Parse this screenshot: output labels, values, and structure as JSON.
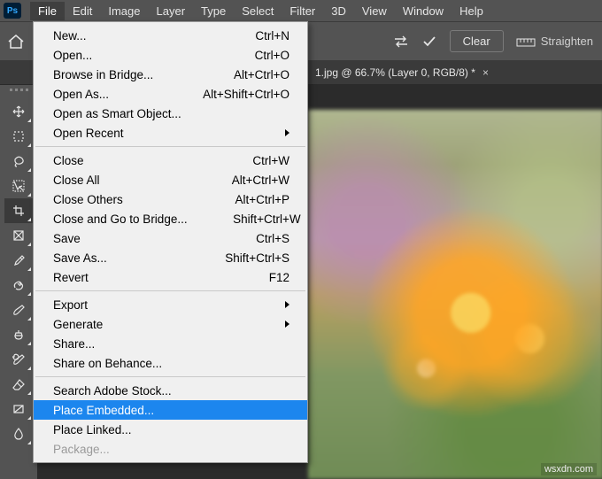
{
  "menubar": {
    "items": [
      "File",
      "Edit",
      "Image",
      "Layer",
      "Type",
      "Select",
      "Filter",
      "3D",
      "View",
      "Window",
      "Help"
    ],
    "open_index": 0
  },
  "options_bar": {
    "clear_label": "Clear",
    "straighten_label": "Straighten"
  },
  "document_tab": {
    "title": "1.jpg @ 66.7% (Layer 0, RGB/8) *"
  },
  "tools": [
    {
      "name": "move-tool"
    },
    {
      "name": "marquee-tool"
    },
    {
      "name": "lasso-tool"
    },
    {
      "name": "quick-select-tool"
    },
    {
      "name": "crop-tool",
      "active": true
    },
    {
      "name": "frame-tool"
    },
    {
      "name": "eyedropper-tool"
    },
    {
      "name": "healing-brush-tool"
    },
    {
      "name": "brush-tool"
    },
    {
      "name": "clone-stamp-tool"
    },
    {
      "name": "history-brush-tool"
    },
    {
      "name": "eraser-tool"
    },
    {
      "name": "gradient-tool"
    },
    {
      "name": "blur-tool"
    }
  ],
  "dropdown": {
    "groups": [
      [
        {
          "label": "New...",
          "shortcut": "Ctrl+N"
        },
        {
          "label": "Open...",
          "shortcut": "Ctrl+O"
        },
        {
          "label": "Browse in Bridge...",
          "shortcut": "Alt+Ctrl+O"
        },
        {
          "label": "Open As...",
          "shortcut": "Alt+Shift+Ctrl+O"
        },
        {
          "label": "Open as Smart Object..."
        },
        {
          "label": "Open Recent",
          "submenu": true
        }
      ],
      [
        {
          "label": "Close",
          "shortcut": "Ctrl+W"
        },
        {
          "label": "Close All",
          "shortcut": "Alt+Ctrl+W"
        },
        {
          "label": "Close Others",
          "shortcut": "Alt+Ctrl+P"
        },
        {
          "label": "Close and Go to Bridge...",
          "shortcut": "Shift+Ctrl+W"
        },
        {
          "label": "Save",
          "shortcut": "Ctrl+S"
        },
        {
          "label": "Save As...",
          "shortcut": "Shift+Ctrl+S"
        },
        {
          "label": "Revert",
          "shortcut": "F12"
        }
      ],
      [
        {
          "label": "Export",
          "submenu": true
        },
        {
          "label": "Generate",
          "submenu": true
        },
        {
          "label": "Share..."
        },
        {
          "label": "Share on Behance..."
        }
      ],
      [
        {
          "label": "Search Adobe Stock..."
        },
        {
          "label": "Place Embedded...",
          "highlight": true
        },
        {
          "label": "Place Linked..."
        },
        {
          "label": "Package...",
          "disabled": true
        }
      ]
    ]
  },
  "watermark": "wsxdn.com"
}
